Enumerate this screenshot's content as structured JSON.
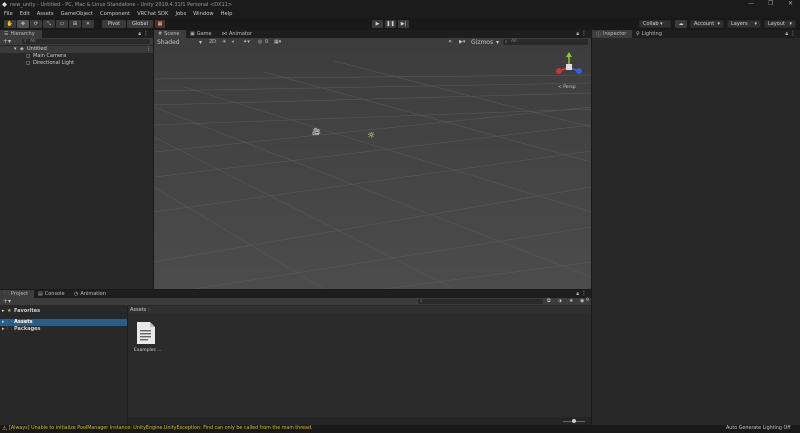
{
  "window": {
    "title": "new_unity - Untitled - PC, Mac & Linux Standalone - Unity 2019.4.31f1 Personal <DX11>",
    "controls": [
      "—",
      "❐",
      "✕"
    ]
  },
  "menu": [
    "File",
    "Edit",
    "Assets",
    "GameObject",
    "Component",
    "VRChat SDK",
    "Jobs",
    "Window",
    "Help"
  ],
  "toolbar": {
    "pivot": "Pivot",
    "global": "Global",
    "collab": "Collab ▾",
    "account": "Account",
    "layers": "Layers",
    "layout": "Layout"
  },
  "hierarchy": {
    "tab": "Hierarchy",
    "search_placeholder": "All",
    "scene": "Untitled",
    "items": [
      "Main Camera",
      "Directional Light"
    ]
  },
  "scene_panel": {
    "tabs": [
      "Scene",
      "Game",
      "Animator"
    ],
    "shading": "Shaded",
    "mode_2d": "2D",
    "gizmos": "Gizmos",
    "search_placeholder": "All",
    "persp": "< Persp",
    "fx_count": "0"
  },
  "inspector": {
    "tabs": [
      "Inspector",
      "Lighting"
    ]
  },
  "project": {
    "tabs": [
      "Project",
      "Console",
      "Animation"
    ],
    "favorites": "Favorites",
    "assets": "Assets",
    "packages": "Packages",
    "breadcrumb": "Assets",
    "file_label": "Examples ...",
    "count": "9"
  },
  "status": {
    "message": "[Always] Unable to initialize PoolManager Instance: UnityEngine.UnityException: Find can only be called from the main thread.",
    "right": "Auto Generate Lighting Off"
  },
  "colors": {
    "accent": "#2c5d87",
    "warning": "#e2b53a",
    "panel": "#282828"
  }
}
